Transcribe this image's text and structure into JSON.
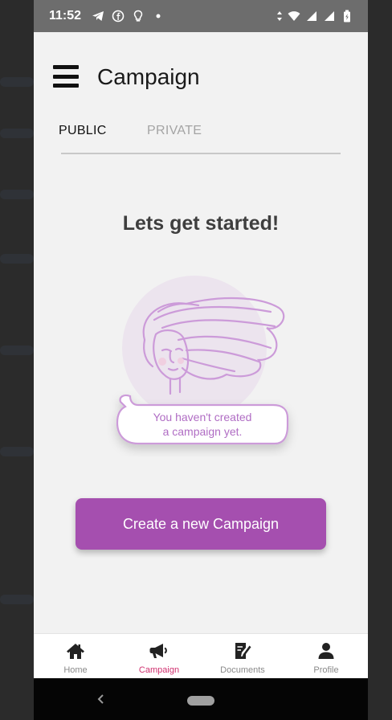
{
  "status_bar": {
    "time": "11:52",
    "left_icons": [
      "telegram-icon",
      "facebook-icon",
      "lightbulb-icon",
      "dot-icon"
    ],
    "right_icons": [
      "data-arrows-icon",
      "wifi-icon",
      "signal-icon",
      "signal-icon",
      "battery-icon"
    ]
  },
  "header": {
    "title": "Campaign"
  },
  "tabs": [
    {
      "label": "PUBLIC",
      "active": true
    },
    {
      "label": "PRIVATE",
      "active": false
    }
  ],
  "main": {
    "heading": "Lets get started!",
    "empty_message_line1": "You haven't created",
    "empty_message_line2": "a  campaign yet.",
    "create_button_label": "Create a new Campaign"
  },
  "bottom_nav": [
    {
      "label": "Home",
      "icon": "home-icon",
      "active": false
    },
    {
      "label": "Campaign",
      "icon": "megaphone-icon",
      "active": true
    },
    {
      "label": "Documents",
      "icon": "document-edit-icon",
      "active": false
    },
    {
      "label": "Profile",
      "icon": "person-icon",
      "active": false
    }
  ],
  "colors": {
    "accent": "#a54faf",
    "active_nav": "#d0306f",
    "status_bar": "#6d6d6d",
    "illustration": "#cc9bd9"
  }
}
